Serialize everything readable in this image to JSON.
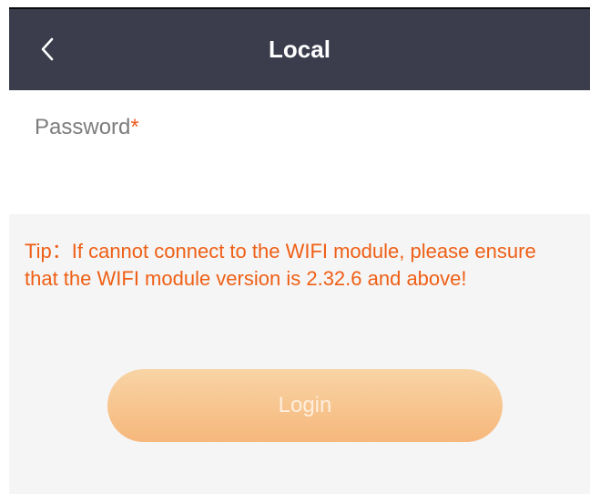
{
  "header": {
    "title": "Local",
    "back_icon": "chevron-left-icon"
  },
  "password": {
    "label": "Password",
    "required_mark": "*",
    "value": "",
    "placeholder": ""
  },
  "tip": {
    "text": "Tip：If cannot connect to the WIFI module, please ensure that the WIFI module version is 2.32.6 and above!"
  },
  "login": {
    "label": "Login"
  },
  "colors": {
    "header_bg": "#3b3d4d",
    "accent": "#ef5f15",
    "login_gradient_top": "#f8d4a5",
    "login_gradient_bottom": "#f6b77b",
    "page_bg": "#f5f5f5"
  }
}
